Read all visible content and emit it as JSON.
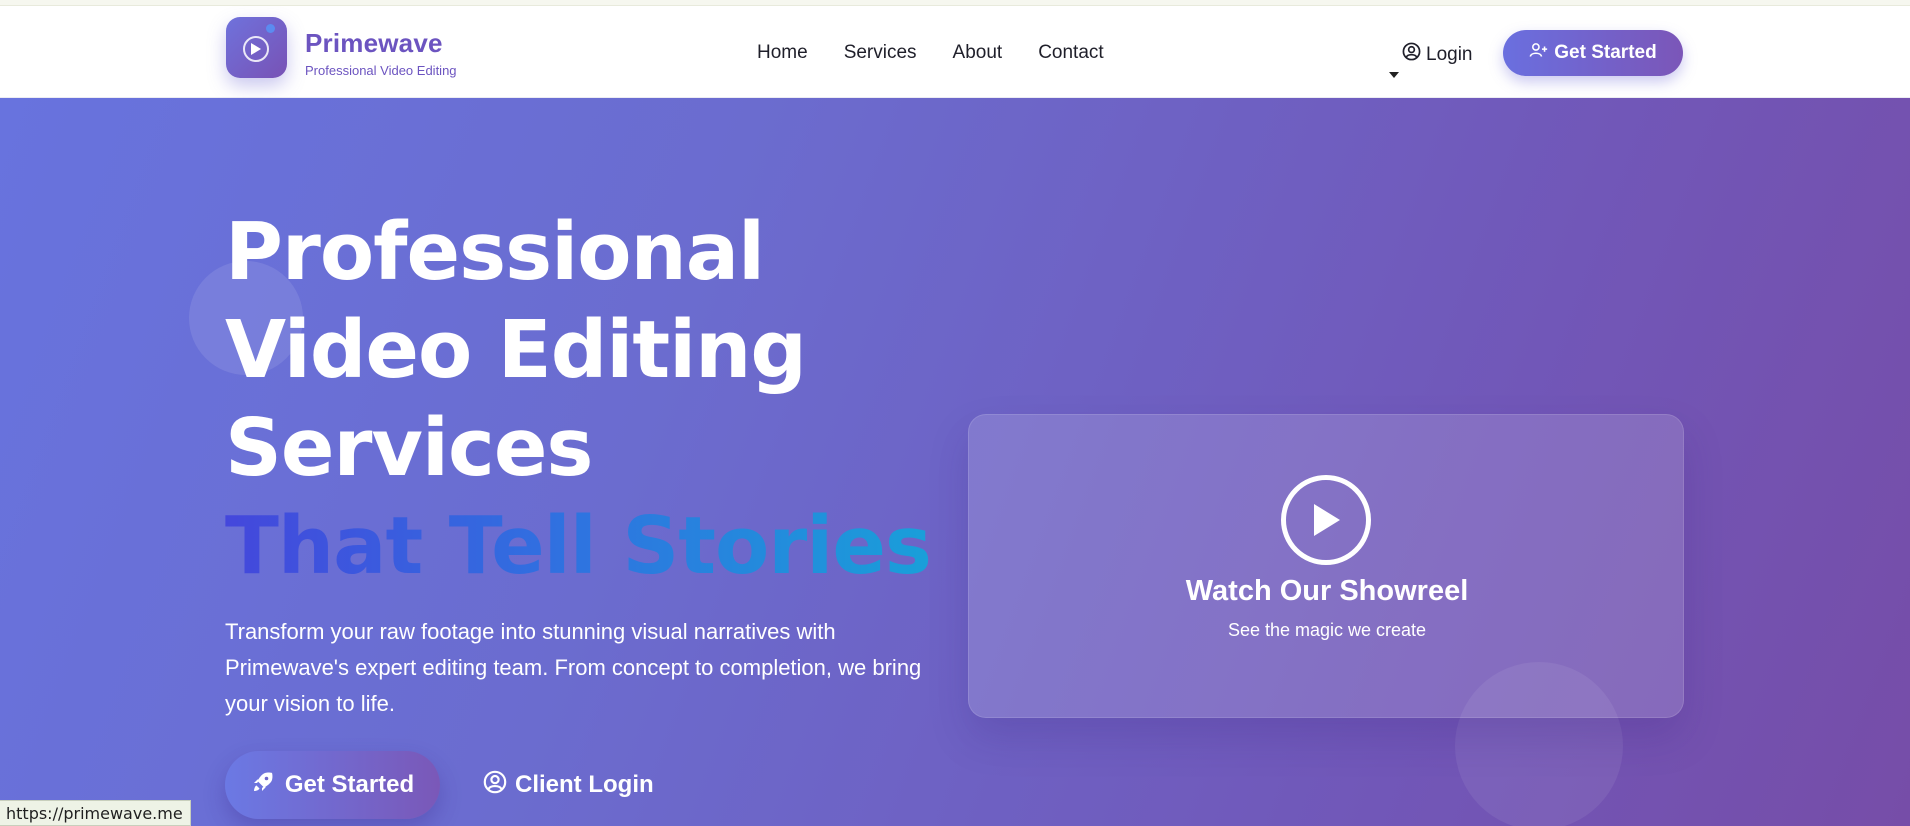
{
  "header": {
    "brand_name": "Primewave",
    "brand_tagline": "Professional Video Editing",
    "nav": [
      {
        "label": "Home"
      },
      {
        "label": "Services"
      },
      {
        "label": "About"
      },
      {
        "label": "Contact"
      }
    ],
    "login_label": "Login",
    "cta_label": "Get Started"
  },
  "hero": {
    "title_lines": [
      "Professional",
      "Video Editing",
      "Services"
    ],
    "title_gradient_words": [
      "That Tell",
      "Stories"
    ],
    "description": "Transform your raw footage into stunning visual narratives with Primewave's expert editing team. From concept to completion, we bring your vision to life.",
    "primary_cta": "Get Started",
    "secondary_cta": "Client Login"
  },
  "showreel": {
    "title": "Watch Our Showreel",
    "subtitle": "See the magic we create"
  },
  "status_url": "https://primewave.me",
  "colors": {
    "brand": "#6c54c0",
    "hero_start": "#6873de",
    "hero_end": "#764da8",
    "title_gradient_start": "#4447dc",
    "title_gradient_end": "#16a6d8"
  },
  "icons": [
    "play-icon",
    "user-circle-icon",
    "user-plus-icon",
    "rocket-icon",
    "caret-down-icon"
  ]
}
